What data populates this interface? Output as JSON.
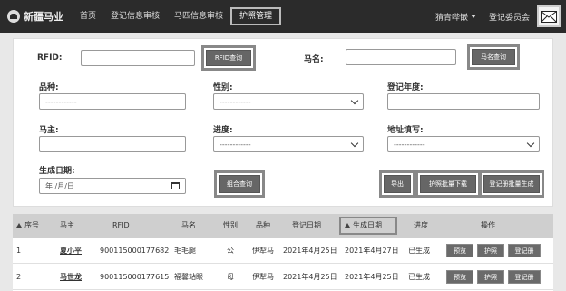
{
  "header": {
    "logo_text": "新疆马业",
    "nav": [
      "首页",
      "登记信息审核",
      "马匹信息审核",
      "护照管理"
    ],
    "active_index": 3,
    "user": "猜青哔嵌",
    "org": "登记委员会"
  },
  "form": {
    "rfid_label": "RFID:",
    "rfid_query": "RFID查询",
    "horse_name_label": "马名:",
    "horse_name_query": "马名查询",
    "breed_label": "品种:",
    "breed_value": "------------",
    "gender_label": "性别:",
    "gender_value": "------------",
    "reg_year_label": "登记年度:",
    "owner_label": "马主:",
    "progress_label": "进度:",
    "progress_value": "------------",
    "region_label": "地址填写:",
    "region_value": "------------",
    "birth_label": "生成日期:",
    "date_placeholder": "年 /月/日",
    "combo_query": "组合查询",
    "export": "导出",
    "passport_batch_download": "护照批量下载",
    "cert_batch_generate": "登记册批量生成"
  },
  "table": {
    "headers": [
      "序号",
      "马主",
      "RFID",
      "马名",
      "性别",
      "品种",
      "登记日期",
      "生成日期",
      "进度",
      "操作"
    ],
    "rows": [
      {
        "index": "1",
        "owner": "夏小平",
        "rfid": "900115000177682",
        "name": "毛毛腿",
        "gender": "公",
        "breed": "伊犁马",
        "reg_date": "2021年4月25日",
        "gen_date": "2021年4月27日",
        "progress": "已生成"
      },
      {
        "index": "2",
        "owner": "马世龙",
        "rfid": "900115000177615",
        "name": "福馨站眼",
        "gender": "母",
        "breed": "伊犁马",
        "reg_date": "2021年4月25日",
        "gen_date": "2021年4月25日",
        "progress": "已生成"
      }
    ],
    "actions": [
      "预览",
      "护照",
      "登记册"
    ]
  }
}
